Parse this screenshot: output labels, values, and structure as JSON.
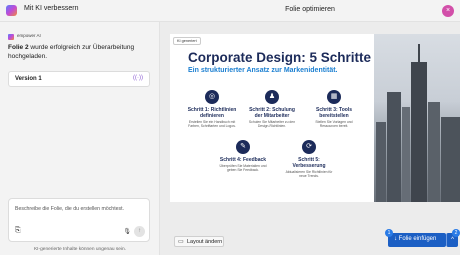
{
  "header": {
    "brand_label": "Mit KI verbessern",
    "title": "Folie optimieren",
    "close_icon": "×"
  },
  "left": {
    "app_name": "empower AI",
    "message_bold": "Folie 2",
    "message_rest": " wurde erfolgreich zur Überarbeitung hochgeladen.",
    "version_label": "Version 1",
    "version_icon": "((·))",
    "prompt_placeholder": "Beschreibe die Folie, die du erstellen möchtest.",
    "attach_icon": "⎘",
    "mic_icon": "🎙",
    "send_icon": "↑",
    "disclaimer": "KI-generierte Inhalte können ungenau sein."
  },
  "slide": {
    "badge": "KI generiert",
    "title": "Corporate Design: 5 Schritte",
    "subtitle": "Ein strukturierter Ansatz zur Markenidentität.",
    "steps": [
      {
        "icon": "◎",
        "title": "Schritt 1: Richtlinien definieren",
        "desc": "Erstellen Sie ein Handbuch mit Farben, Schriftarten und Logos."
      },
      {
        "icon": "♟",
        "title": "Schritt 2: Schulung der Mitarbeiter",
        "desc": "Schulen Sie Mitarbeiter zu den Design-Richtlinien."
      },
      {
        "icon": "▦",
        "title": "Schritt 3: Tools bereitstellen",
        "desc": "Stellen Sie Vorlagen und Ressourcen bereit."
      },
      {
        "icon": "✎",
        "title": "Schritt 4: Feedback",
        "desc": "Überprüfen Sie Materialien und geben Sie Feedback."
      },
      {
        "icon": "⟳",
        "title": "Schritt 5: Verbesserung",
        "desc": "Aktualisieren Sie Richtlinien für neue Trends."
      }
    ]
  },
  "bottom": {
    "layout_icon": "▭",
    "layout_label": "Layout ändern",
    "insert_label": "↓  Folie einfügen",
    "chevron": "^",
    "badge_left": "1",
    "badge_right": "2"
  },
  "colors": {
    "accent": "#1c5fc4",
    "navy": "#1c2b5a",
    "subtitle_blue": "#1b7fd1",
    "close_pink": "#d24fa9"
  }
}
